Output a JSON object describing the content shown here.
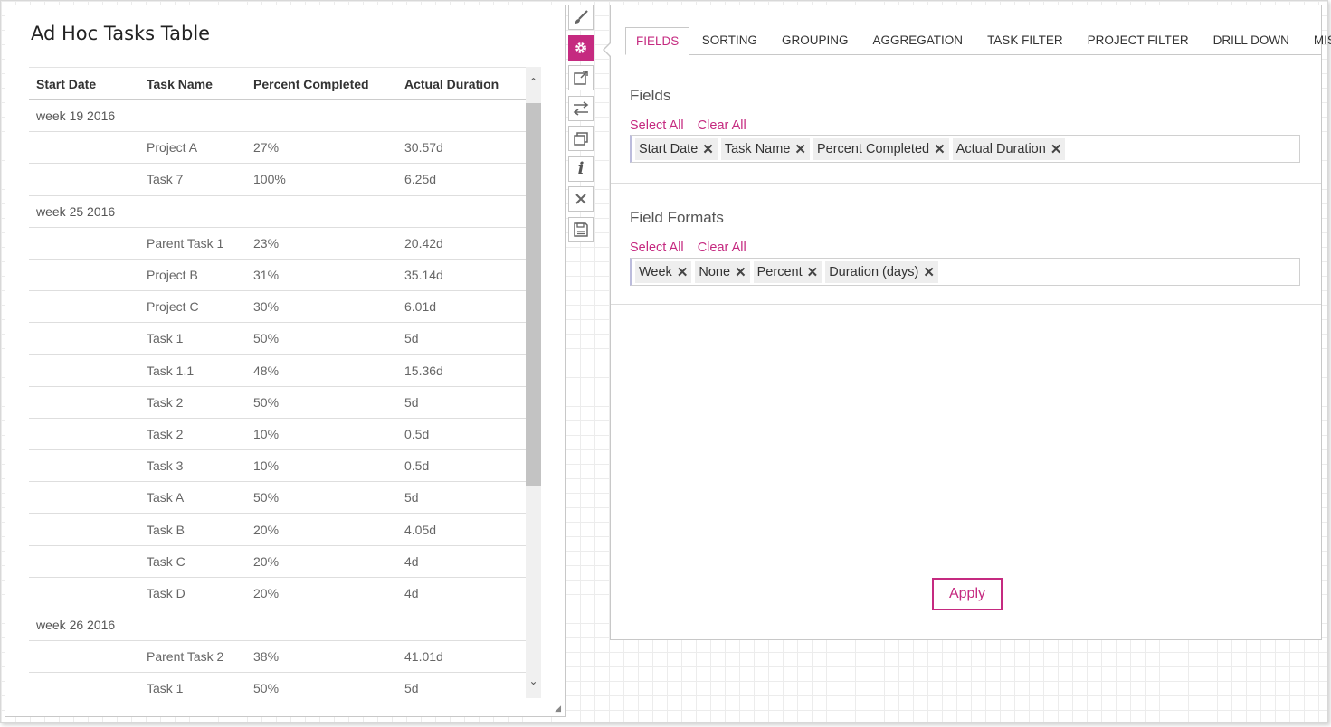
{
  "widget": {
    "title": "Ad Hoc Tasks Table",
    "columns": [
      "Start Date",
      "Task Name",
      "Percent Completed",
      "Actual Duration"
    ],
    "rows": [
      {
        "group": "week 19 2016"
      },
      {
        "name": "Project A",
        "pct": "27%",
        "dur": "30.57d"
      },
      {
        "name": "Task 7",
        "pct": "100%",
        "dur": "6.25d"
      },
      {
        "group": "week 25 2016"
      },
      {
        "name": "Parent Task 1",
        "pct": "23%",
        "dur": "20.42d"
      },
      {
        "name": "Project B",
        "pct": "31%",
        "dur": "35.14d"
      },
      {
        "name": "Project C",
        "pct": "30%",
        "dur": "6.01d"
      },
      {
        "name": "Task 1",
        "pct": "50%",
        "dur": "5d"
      },
      {
        "name": "Task 1.1",
        "pct": "48%",
        "dur": "15.36d"
      },
      {
        "name": "Task 2",
        "pct": "50%",
        "dur": "5d"
      },
      {
        "name": "Task 2",
        "pct": "10%",
        "dur": "0.5d"
      },
      {
        "name": "Task 3",
        "pct": "10%",
        "dur": "0.5d"
      },
      {
        "name": "Task A",
        "pct": "50%",
        "dur": "5d"
      },
      {
        "name": "Task B",
        "pct": "20%",
        "dur": "4.05d"
      },
      {
        "name": "Task C",
        "pct": "20%",
        "dur": "4d"
      },
      {
        "name": "Task D",
        "pct": "20%",
        "dur": "4d"
      },
      {
        "group": "week 26 2016"
      },
      {
        "name": "Parent Task 2",
        "pct": "38%",
        "dur": "41.01d"
      },
      {
        "name": "Task 1",
        "pct": "50%",
        "dur": "5d"
      }
    ]
  },
  "toolbar": {
    "tools": [
      "brush-icon",
      "gear-icon",
      "external-link-icon",
      "swap-arrows-icon",
      "copy-icon",
      "info-icon",
      "close-icon",
      "save-icon"
    ],
    "active": "gear-icon"
  },
  "panel": {
    "tabs": [
      "FIELDS",
      "SORTING",
      "GROUPING",
      "AGGREGATION",
      "TASK FILTER",
      "PROJECT FILTER",
      "DRILL DOWN",
      "MISC"
    ],
    "active_tab": "FIELDS",
    "fields_section": {
      "title": "Fields",
      "select_all": "Select All",
      "clear_all": "Clear All",
      "chips": [
        "Start Date",
        "Task Name",
        "Percent Completed",
        "Actual Duration"
      ]
    },
    "formats_section": {
      "title": "Field Formats",
      "select_all": "Select All",
      "clear_all": "Clear All",
      "chips": [
        "Week",
        "None",
        "Percent",
        "Duration (days)"
      ]
    },
    "apply_label": "Apply"
  },
  "colors": {
    "accent": "#c52a80"
  }
}
